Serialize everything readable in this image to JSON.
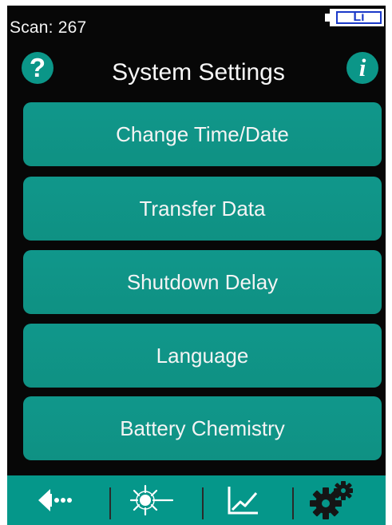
{
  "status": {
    "scan_label": "Scan: 267",
    "battery_type": "Li"
  },
  "header": {
    "title": "System Settings",
    "help_icon": "question-mark-icon",
    "info_icon": "info-icon"
  },
  "menu": {
    "items": [
      {
        "label": "Change Time/Date"
      },
      {
        "label": "Transfer Data"
      },
      {
        "label": "Shutdown Delay"
      },
      {
        "label": "Language"
      },
      {
        "label": "Battery Chemistry"
      }
    ]
  },
  "toolbar": {
    "items": [
      {
        "icon": "back-arrow-icon"
      },
      {
        "icon": "laser-scan-icon"
      },
      {
        "icon": "chart-line-icon"
      },
      {
        "icon": "gear-icon"
      }
    ]
  },
  "colors": {
    "accent": "#0f968a",
    "background": "#070707",
    "text": "#f4f4f4",
    "battery_outline": "#1a39c9"
  }
}
